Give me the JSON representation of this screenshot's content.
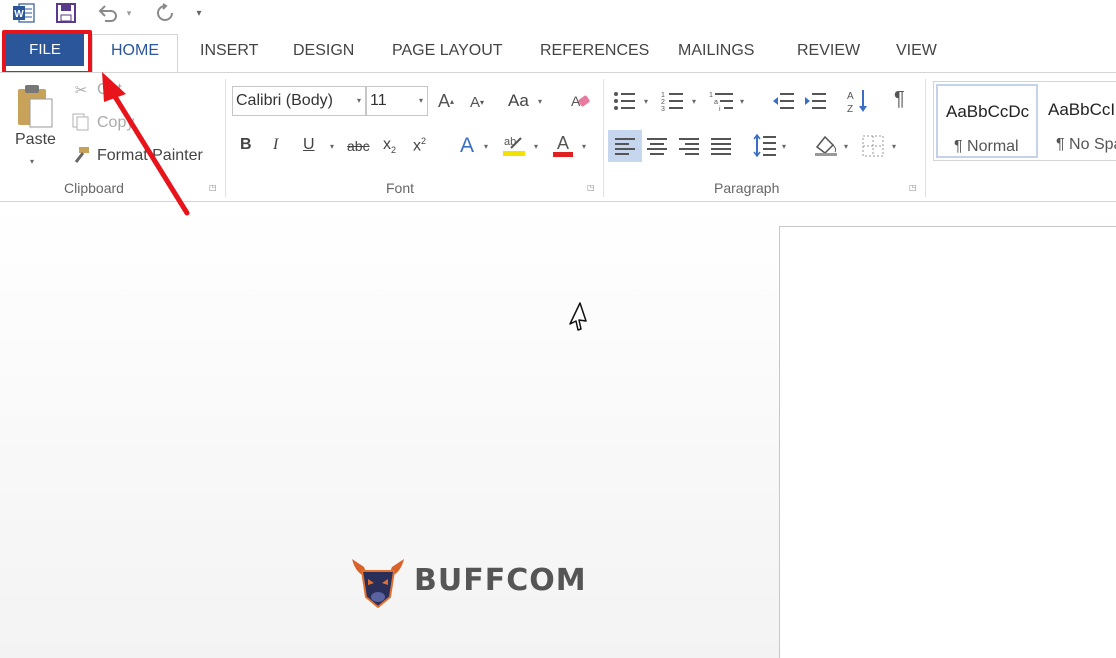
{
  "qat": {
    "icons": [
      "word-icon",
      "save-icon",
      "undo-icon",
      "redo-icon",
      "customize-icon"
    ]
  },
  "tabs": {
    "file": "FILE",
    "home": "HOME",
    "insert": "INSERT",
    "design": "DESIGN",
    "page_layout": "PAGE LAYOUT",
    "references": "REFERENCES",
    "mailings": "MAILINGS",
    "review": "REVIEW",
    "view": "VIEW"
  },
  "clipboard": {
    "paste": "Paste",
    "cut": "Cut",
    "copy": "Copy",
    "format_painter": "Format Painter",
    "label": "Clipboard"
  },
  "font": {
    "name": "Calibri (Body)",
    "size": "11",
    "change_case": "Aa",
    "bold": "B",
    "italic": "I",
    "underline": "U",
    "strikethrough": "abc",
    "subscript": "x",
    "superscript": "x",
    "label": "Font",
    "highlight_color": "#f2e200",
    "font_color": "#e02020"
  },
  "paragraph": {
    "label": "Paragraph",
    "pilcrow": "¶"
  },
  "styles": {
    "items": [
      {
        "sample": "AaBbCcDc",
        "name": "¶ Normal"
      },
      {
        "sample": "AaBbCcI",
        "name": "¶ No Spac"
      }
    ]
  },
  "watermark": {
    "text": "BUFFCOM"
  },
  "colors": {
    "accent": "#2b579a",
    "annotation": "#e8141c"
  }
}
